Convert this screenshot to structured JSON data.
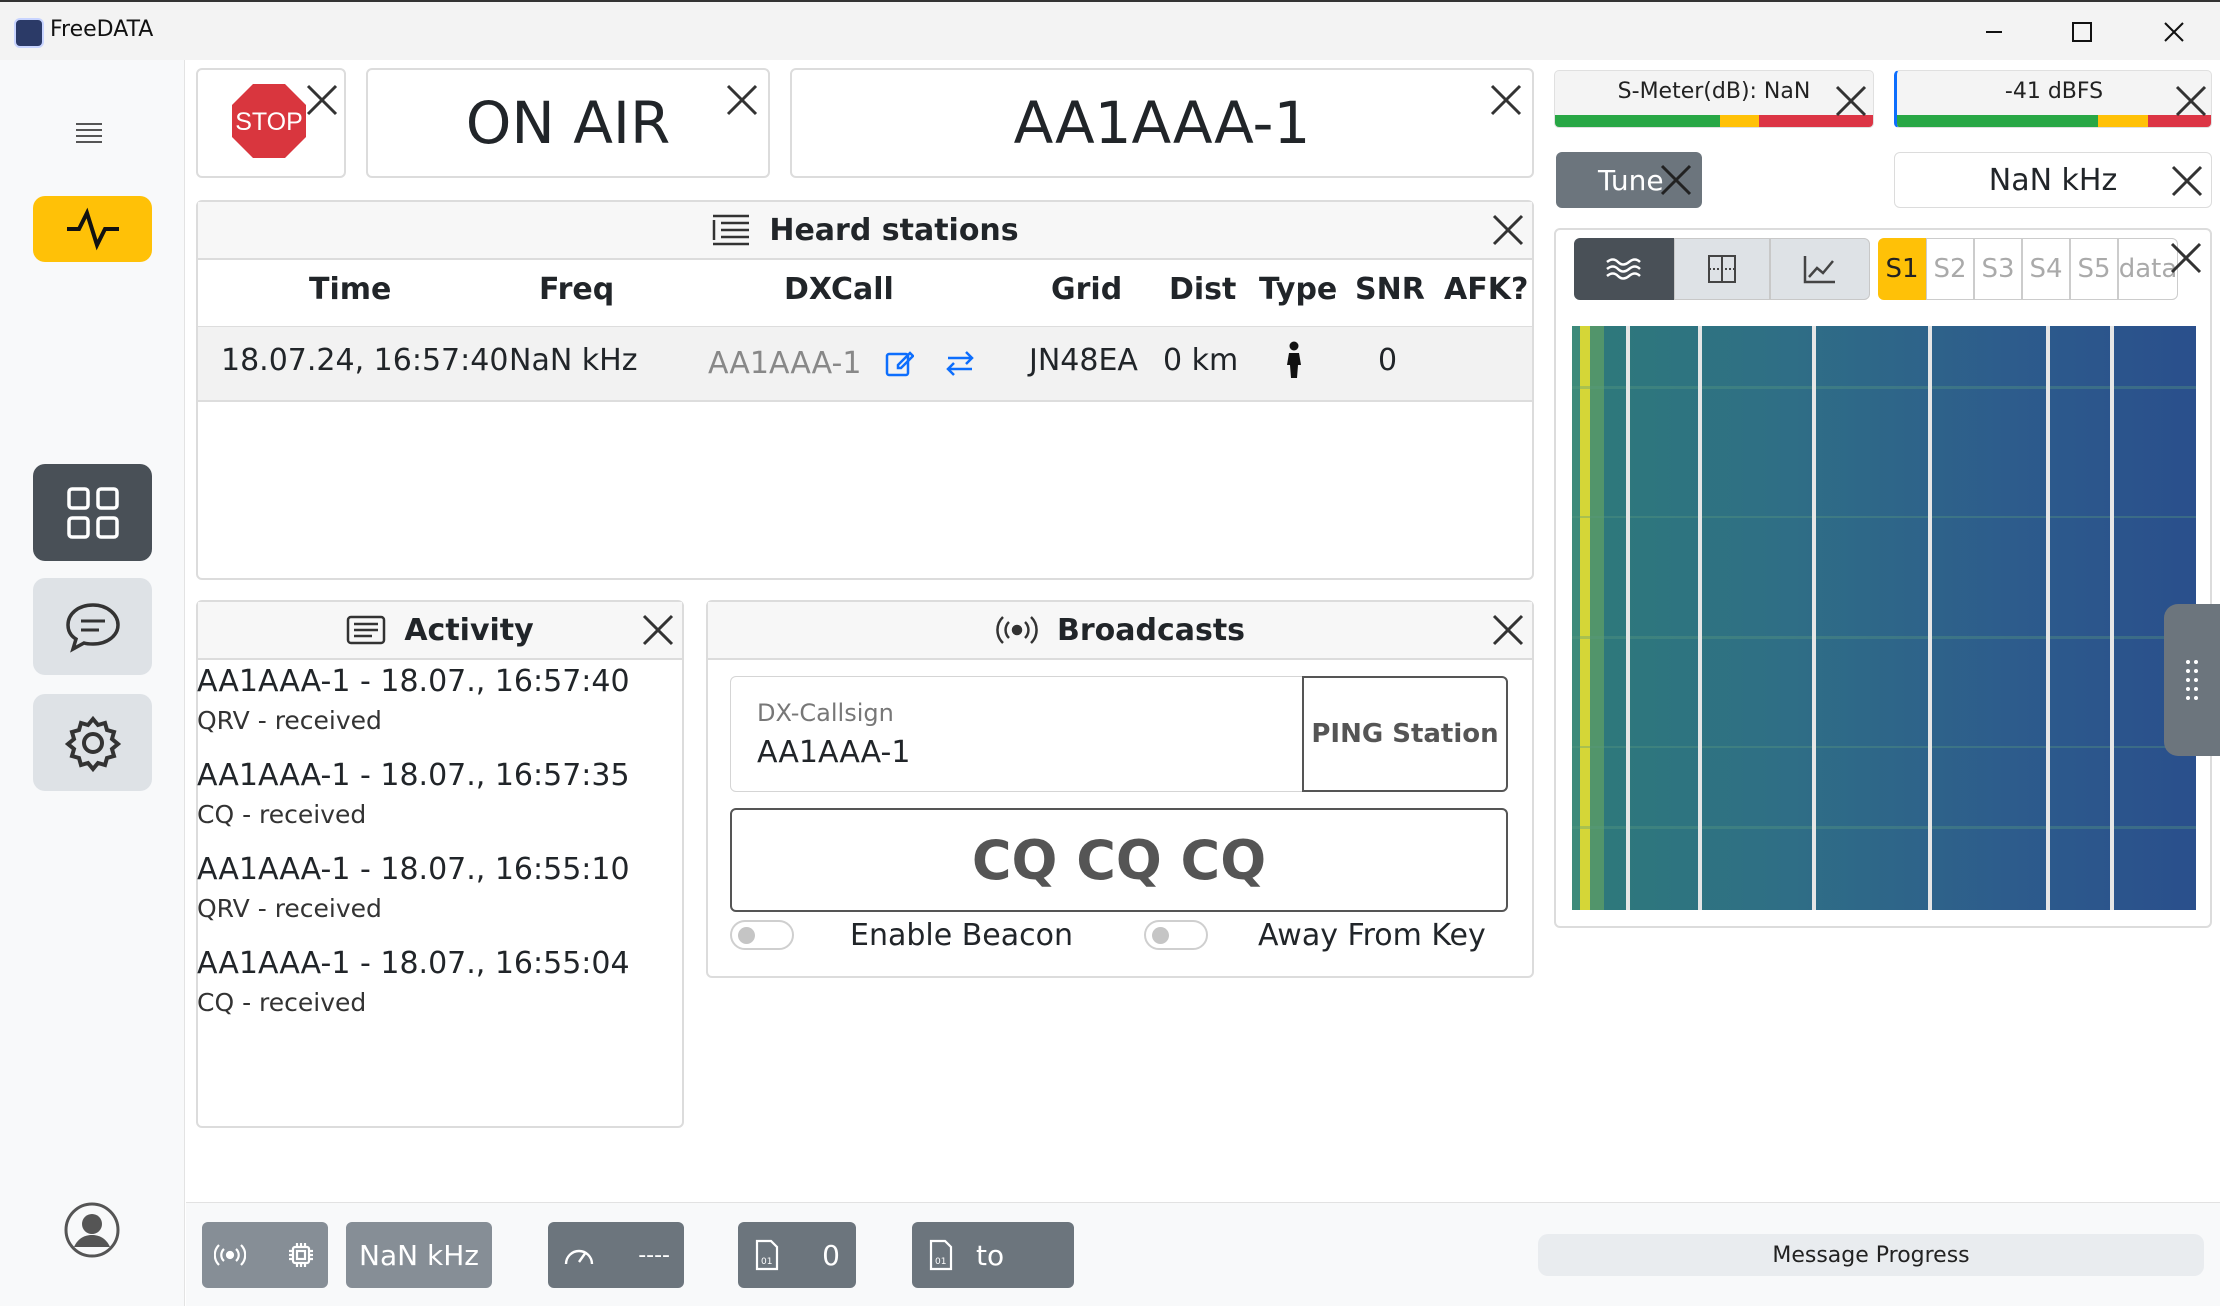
{
  "window": {
    "title": "FreeDATA"
  },
  "top": {
    "stop_label": "STOP",
    "on_air_label": "ON AIR",
    "callsign": "AA1AAA-1"
  },
  "meters": {
    "s_meter_label": "S-Meter(dB): NaN",
    "dbfs_label": "-41 dBFS",
    "tune_label": "Tune",
    "freq_label": "NaN kHz"
  },
  "spectrum": {
    "slots": [
      "S1",
      "S2",
      "S3",
      "S4",
      "S5",
      "data"
    ],
    "selected_slot": "S1"
  },
  "heard": {
    "title": "Heard stations",
    "columns": [
      "Time",
      "Freq",
      "DXCall",
      "Grid",
      "Dist",
      "Type",
      "SNR",
      "AFK?"
    ],
    "rows": [
      {
        "time": "18.07.24, 16:57:40",
        "freq": "NaN kHz",
        "dxcall": "AA1AAA-1",
        "grid": "JN48EA",
        "dist": "0 km",
        "type": "person-icon",
        "snr": "0",
        "afk": ""
      }
    ]
  },
  "activity": {
    "title": "Activity",
    "items": [
      {
        "title": "AA1AAA-1 - 18.07., 16:57:40",
        "sub": "QRV - received"
      },
      {
        "title": "AA1AAA-1 - 18.07., 16:57:35",
        "sub": "CQ - received"
      },
      {
        "title": "AA1AAA-1 - 18.07., 16:55:10",
        "sub": "QRV - received"
      },
      {
        "title": "AA1AAA-1 - 18.07., 16:55:04",
        "sub": "CQ - received"
      }
    ]
  },
  "broadcasts": {
    "title": "Broadcasts",
    "dx_label": "DX-Callsign",
    "dx_value": "AA1AAA-1",
    "ping_label": "PING Station",
    "cq_label": "CQ CQ CQ",
    "beacon_label": "Enable Beacon",
    "afk_label": "Away From Key"
  },
  "footer": {
    "freq": "NaN kHz",
    "speed": "----",
    "count": "0",
    "to": "to",
    "progress_label": "Message Progress"
  },
  "colors": {
    "accent": "#ffc107",
    "dark": "#495057",
    "stop_red": "#d9363e",
    "link_blue": "#0d6efd"
  }
}
